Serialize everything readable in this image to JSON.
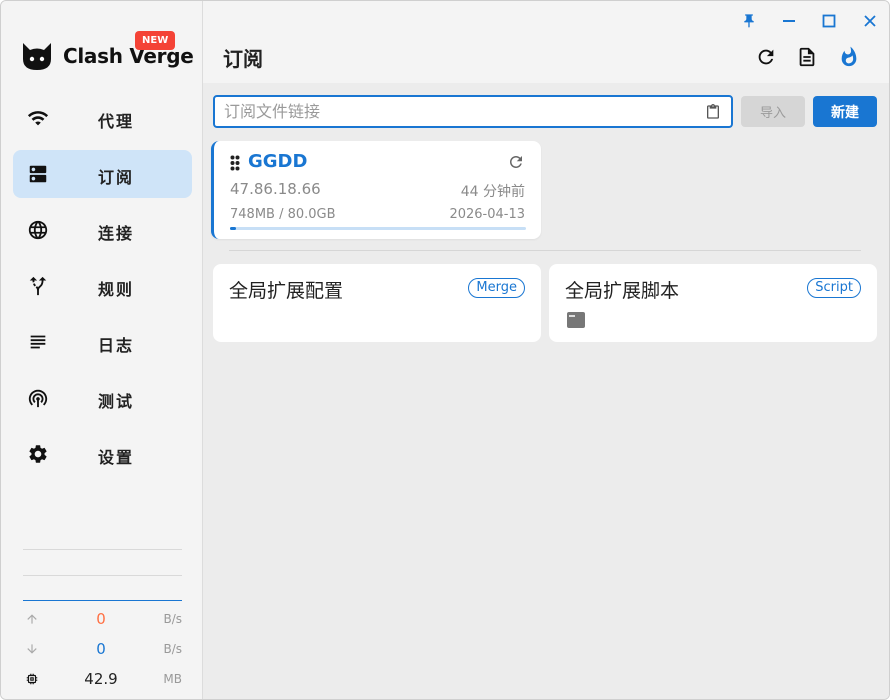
{
  "app": {
    "name": "Clash Verge",
    "new_badge": "NEW"
  },
  "sidebar": {
    "items": [
      {
        "label": "代理",
        "icon": "wifi-icon",
        "active": false
      },
      {
        "label": "订阅",
        "icon": "dns-icon",
        "active": true
      },
      {
        "label": "连接",
        "icon": "globe-icon",
        "active": false
      },
      {
        "label": "规则",
        "icon": "route-icon",
        "active": false
      },
      {
        "label": "日志",
        "icon": "subject-icon",
        "active": false
      },
      {
        "label": "测试",
        "icon": "radar-icon",
        "active": false
      },
      {
        "label": "设置",
        "icon": "gear-icon",
        "active": false
      }
    ],
    "traffic": {
      "upload_value": "0",
      "upload_unit": "B/s",
      "download_value": "0",
      "download_unit": "B/s",
      "memory_value": "42.9",
      "memory_unit": "MB"
    }
  },
  "header": {
    "title": "订阅",
    "window_controls": [
      "pin-icon",
      "minimize-icon",
      "maximize-icon",
      "close-icon"
    ],
    "actions": [
      "refresh-icon",
      "document-icon",
      "fire-icon"
    ]
  },
  "subscribe": {
    "url_placeholder": "订阅文件链接",
    "url_value": "",
    "import_label": "导入",
    "new_label": "新建"
  },
  "profiles": [
    {
      "name": "GGDD",
      "host": "47.86.18.66",
      "updated": "44 分钟前",
      "usage": "748MB / 80.0GB",
      "expire": "2026-04-13",
      "usage_fraction": 0.0091
    }
  ],
  "extensions": [
    {
      "title": "全局扩展配置",
      "tag": "Merge",
      "has_file_icon": false
    },
    {
      "title": "全局扩展脚本",
      "tag": "Script",
      "has_file_icon": true
    }
  ],
  "colors": {
    "accent": "#1976d2",
    "active_nav_bg": "#cfe4f8",
    "upload_value": "#ff7043",
    "download_value": "#1976d2",
    "badge": "#f44336"
  }
}
